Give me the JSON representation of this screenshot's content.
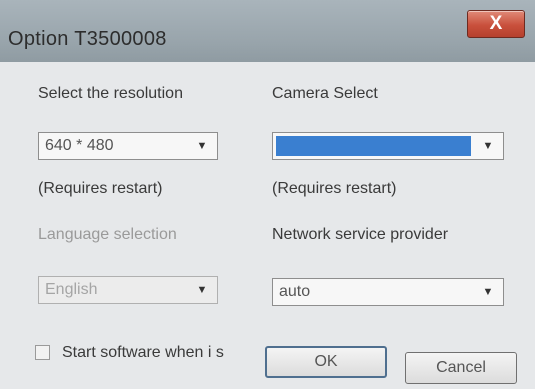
{
  "window": {
    "title": "Option T3500008",
    "close_label": "X"
  },
  "resolution": {
    "label": "Select the resolution",
    "value": "640 * 480",
    "note": "(Requires restart)"
  },
  "camera": {
    "label": "Camera Select",
    "value": "",
    "note": "(Requires restart)"
  },
  "language": {
    "label": "Language selection",
    "value": "English"
  },
  "network": {
    "label": "Network service provider",
    "value": "auto"
  },
  "startup": {
    "label": "Start software when i s"
  },
  "buttons": {
    "ok": "OK",
    "cancel": "Cancel"
  },
  "colors": {
    "selection": "#3a7fd0",
    "close": "#c9503c"
  }
}
